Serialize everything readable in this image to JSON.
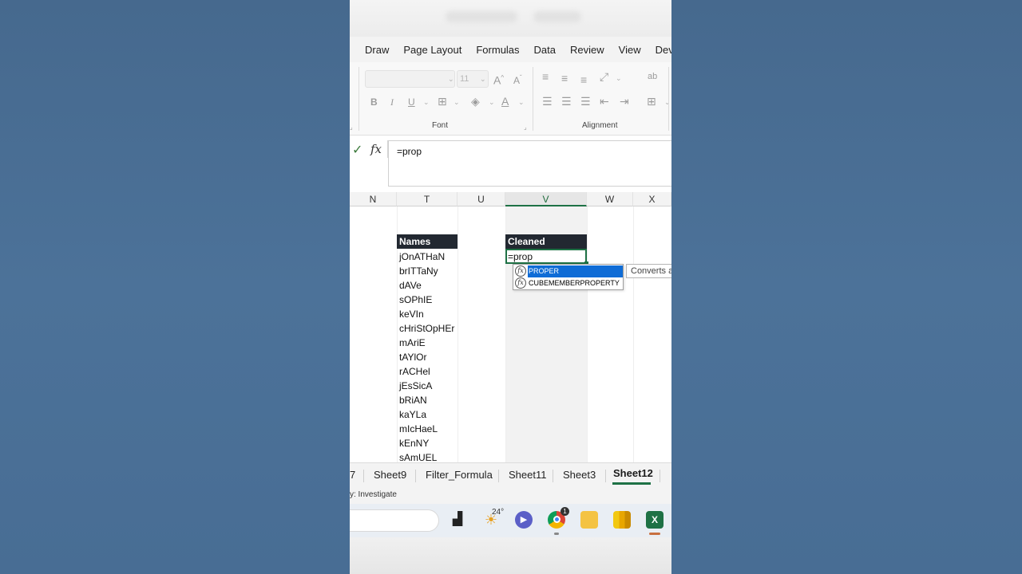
{
  "ribbon": {
    "menu": [
      "Draw",
      "Page Layout",
      "Formulas",
      "Data",
      "Review",
      "View",
      "Develop"
    ],
    "font_size_value": "11",
    "font_group_label": "Font",
    "alignment_group_label": "Alignment",
    "bold": "B",
    "italic": "I",
    "underline": "U"
  },
  "formula_bar": {
    "fx_label": "fx",
    "content": "=prop"
  },
  "columns": [
    "N",
    "T",
    "U",
    "V",
    "W",
    "X"
  ],
  "active_column": "V",
  "table": {
    "names_header": "Names",
    "cleaned_header": "Cleaned",
    "names": [
      "jOnATHaN",
      "brITTaNy",
      "dAVe",
      "sOPhIE",
      "keVIn",
      "cHriStOpHEr",
      "mAriE",
      "tAYlOr",
      "rACHel",
      "jEsSicA",
      "bRiAN",
      "kaYLa",
      "mIcHaeL",
      "kEnNY",
      "sAmUEL"
    ]
  },
  "active_cell_value": "=prop",
  "autocomplete": {
    "items": [
      "PROPER",
      "CUBEMEMBERPROPERTY"
    ],
    "selected_index": 0,
    "tooltip": "Converts a"
  },
  "sheet_tabs": [
    "7",
    "Sheet9",
    "Filter_Formula",
    "Sheet11",
    "Sheet3",
    "Sheet12"
  ],
  "active_sheet": "Sheet12",
  "status": {
    "text": "y: Investigate"
  },
  "taskbar": {
    "weather_temp": "24°",
    "icons": [
      "task-view-icon",
      "weather-icon",
      "chat-icon",
      "chrome-icon",
      "file-explorer-icon",
      "power-bi-icon",
      "excel-icon"
    ],
    "chrome_badge": "1"
  },
  "colors": {
    "excel_green": "#1e7145",
    "header_dark": "#222831",
    "selection_blue": "#0f6cd6",
    "background": "#4a6f96"
  }
}
